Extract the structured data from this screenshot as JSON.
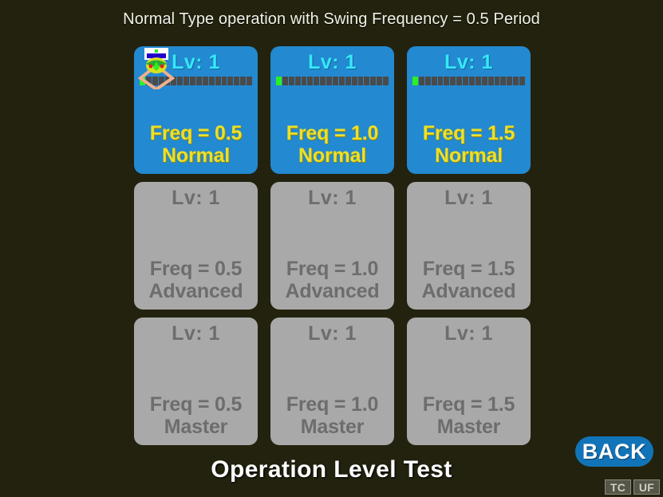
{
  "screen": {
    "background_color": "#22220e",
    "title": "Normal Type operation with Swing Frequency = 0.5 Period",
    "footer_title": "Operation Level Test"
  },
  "theme": {
    "unlocked_card_color": "#2389d0",
    "locked_card_color": "#a9a9a9",
    "level_text_color": "#35e8f8",
    "freq_text_color": "#ece02a",
    "locked_text_color": "#6d6d6d",
    "xp_filled_color": "#2bf024",
    "xp_empty_color": "#4a4a4a",
    "back_button_color": "#1274b8"
  },
  "grid": {
    "rows": 3,
    "columns": 3,
    "xp_total_segments": 18,
    "cards": [
      {
        "level_label": "Lv: 1",
        "freq_label": "Freq = 0.5",
        "difficulty_label": "Normal",
        "state": "unlocked",
        "xp_filled_segments": 1,
        "has_player_sprite": true
      },
      {
        "level_label": "Lv: 1",
        "freq_label": "Freq = 1.0",
        "difficulty_label": "Normal",
        "state": "unlocked",
        "xp_filled_segments": 1,
        "has_player_sprite": false
      },
      {
        "level_label": "Lv: 1",
        "freq_label": "Freq = 1.5",
        "difficulty_label": "Normal",
        "state": "unlocked",
        "xp_filled_segments": 1,
        "has_player_sprite": false
      },
      {
        "level_label": "Lv: 1",
        "freq_label": "Freq = 0.5",
        "difficulty_label": "Advanced",
        "state": "locked",
        "xp_filled_segments": 0,
        "has_player_sprite": false
      },
      {
        "level_label": "Lv: 1",
        "freq_label": "Freq = 1.0",
        "difficulty_label": "Advanced",
        "state": "locked",
        "xp_filled_segments": 0,
        "has_player_sprite": false
      },
      {
        "level_label": "Lv: 1",
        "freq_label": "Freq = 1.5",
        "difficulty_label": "Advanced",
        "state": "locked",
        "xp_filled_segments": 0,
        "has_player_sprite": false
      },
      {
        "level_label": "Lv: 1",
        "freq_label": "Freq = 0.5",
        "difficulty_label": "Master",
        "state": "locked",
        "xp_filled_segments": 0,
        "has_player_sprite": false
      },
      {
        "level_label": "Lv: 1",
        "freq_label": "Freq = 1.0",
        "difficulty_label": "Master",
        "state": "locked",
        "xp_filled_segments": 0,
        "has_player_sprite": false
      },
      {
        "level_label": "Lv: 1",
        "freq_label": "Freq = 1.5",
        "difficulty_label": "Master",
        "state": "locked",
        "xp_filled_segments": 0,
        "has_player_sprite": false
      }
    ]
  },
  "back_button": {
    "label": "BACK"
  },
  "corner_badges": [
    {
      "label": "TC"
    },
    {
      "label": "UF"
    }
  ]
}
